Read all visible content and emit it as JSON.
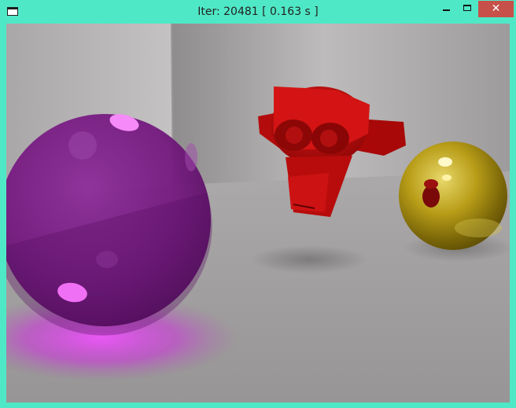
{
  "window": {
    "title": "Iter: 20481 [ 0.163 s ]",
    "controls": {
      "close_glyph": "✕"
    }
  },
  "colors": {
    "frame": "#4fe8c6",
    "close_button": "#c7504a",
    "wall": "#b5b3b3",
    "floor": "#a8a6a6",
    "glass_sphere": "#7a1c86",
    "monkey": "#c40f0f",
    "gold_sphere": "#b8a21a"
  },
  "scene": {
    "objects": [
      "purple-glass-sphere",
      "red-monkey-head",
      "gold-mirror-sphere"
    ]
  }
}
